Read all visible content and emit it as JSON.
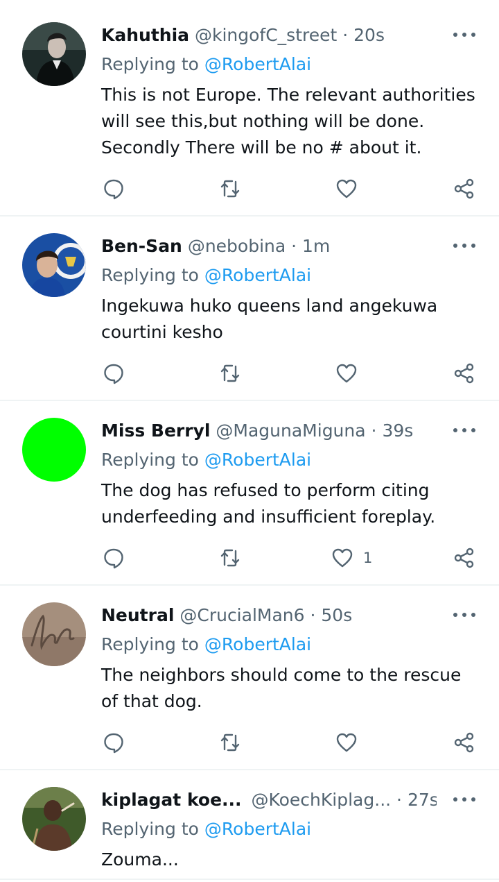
{
  "feed": {
    "reply_prefix": "Replying to",
    "tweets": [
      {
        "name": "Kahuthia",
        "handle": "@kingofC_street",
        "separator": "·",
        "time": "20s",
        "replying_to": "@RobertAlai",
        "text": "This is not Europe. The relevant authorities\nwill see this,but nothing will be done.\nSecondly There will be no # about it.",
        "likes": ""
      },
      {
        "name": "Ben-San",
        "handle": "@nebobina",
        "separator": "·",
        "time": "1m",
        "replying_to": "@RobertAlai",
        "text": "Ingekuwa huko queens land angekuwa\ncourtini kesho",
        "likes": ""
      },
      {
        "name": "Miss Berryl",
        "handle": "@MagunaMiguna",
        "separator": "·",
        "time": "39s",
        "replying_to": "@RobertAlai",
        "text": "The dog has refused to perform citing\nunderfeeding and insufficient foreplay.",
        "likes": "1"
      },
      {
        "name": "Neutral",
        "handle": "@CrucialMan6",
        "separator": "·",
        "time": "50s",
        "replying_to": "@RobertAlai",
        "text": "The neighbors should come to the rescue\nof that dog.",
        "likes": ""
      },
      {
        "name": "kiplagat koe...",
        "handle": "@KoechKiplag...",
        "separator": "·",
        "time": "27s",
        "replying_to": "@RobertAlai",
        "text": "Zouma...",
        "likes": ""
      }
    ]
  },
  "icons": {
    "reply": "reply-icon",
    "retweet": "retweet-icon",
    "like": "heart-icon",
    "share": "share-icon",
    "more": "more-dots-icon"
  },
  "colors": {
    "link": "#1d9bf0",
    "secondary_text": "#536471",
    "primary_text": "#0f1419",
    "divider": "#eff3f4",
    "avatar_miss_berryl": "#00ff00"
  }
}
